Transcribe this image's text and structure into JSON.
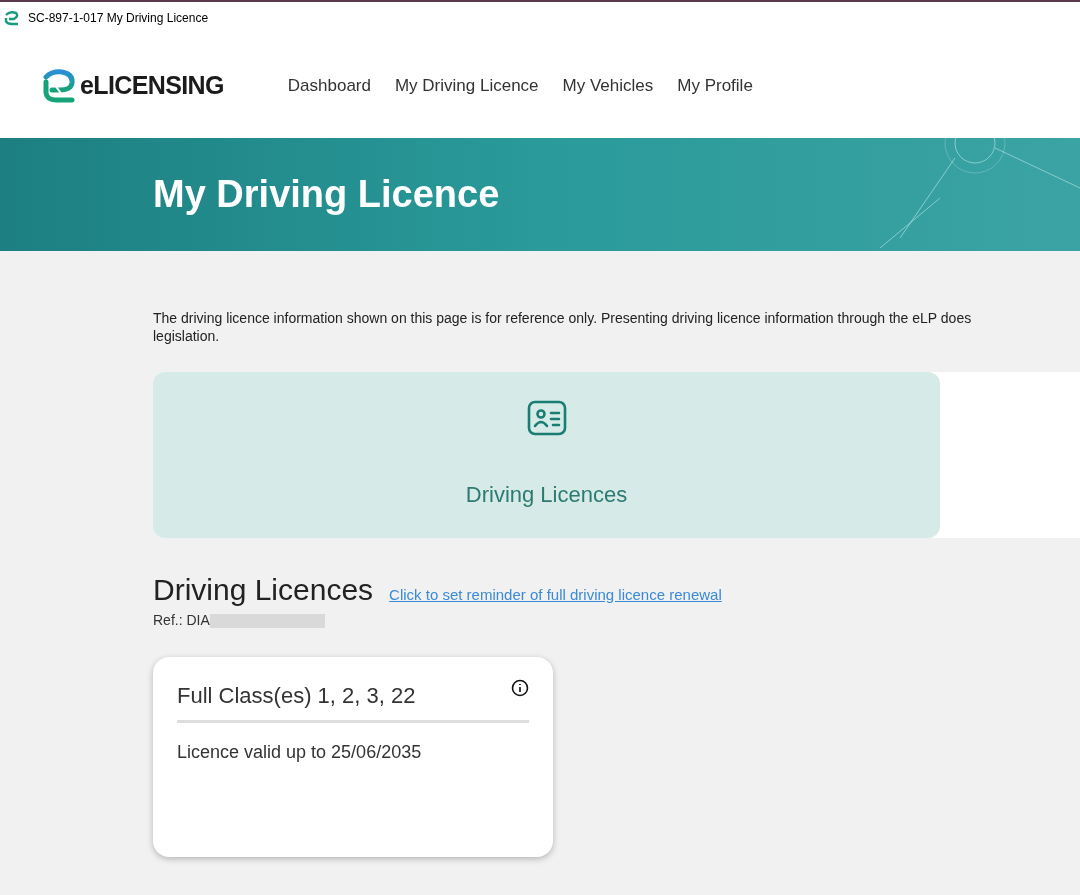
{
  "window": {
    "title": "SC-897-1-017 My Driving Licence"
  },
  "brand": {
    "name": "eLICENSING"
  },
  "nav": [
    {
      "label": "Dashboard"
    },
    {
      "label": "My Driving Licence"
    },
    {
      "label": "My Vehicles"
    },
    {
      "label": "My Profile"
    }
  ],
  "banner": {
    "title": "My Driving Licence"
  },
  "notice": {
    "lines": [
      "The driving licence information shown on this page is for reference only. Presenting driving licence information through the eLP does",
      "legislation."
    ]
  },
  "tiles": [
    {
      "label": "Driving Licences",
      "selected": true
    }
  ],
  "section": {
    "title": "Driving Licences",
    "link": "Click to set reminder of full driving licence renewal",
    "ref": "Ref.: DIA"
  },
  "licences": [
    {
      "title": "Full Class(es) 1, 2, 3, 22",
      "validity": "Licence valid up to 25/06/2035"
    }
  ]
}
